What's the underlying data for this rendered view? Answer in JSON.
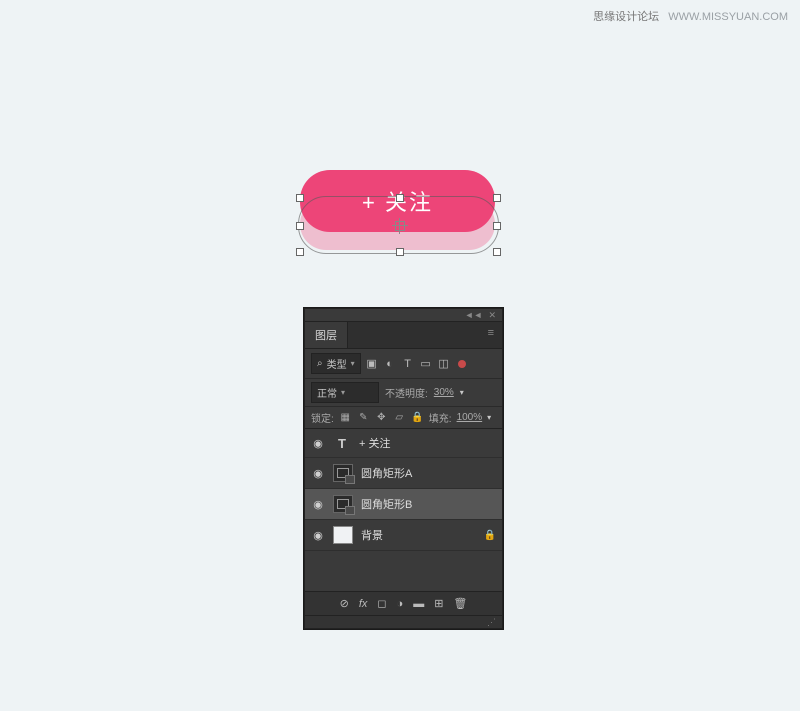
{
  "watermark": {
    "cn": "思缘设计论坛",
    "en": "WWW.MISSYUAN.COM"
  },
  "button_text": "+ 关注",
  "panel": {
    "title": "图层",
    "filter_type": "类型",
    "blend_mode": "正常",
    "opacity_label": "不透明度:",
    "opacity_value": "30%",
    "lock_label": "锁定:",
    "fill_label": "填充:",
    "fill_value": "100%",
    "layers": [
      {
        "name": "+ 关注",
        "type": "text",
        "selected": false,
        "locked": false
      },
      {
        "name": "圆角矩形A",
        "type": "shape",
        "selected": false,
        "locked": false
      },
      {
        "name": "圆角矩形B",
        "type": "shape",
        "selected": true,
        "locked": false
      },
      {
        "name": "背景",
        "type": "bg",
        "selected": false,
        "locked": true
      }
    ]
  }
}
